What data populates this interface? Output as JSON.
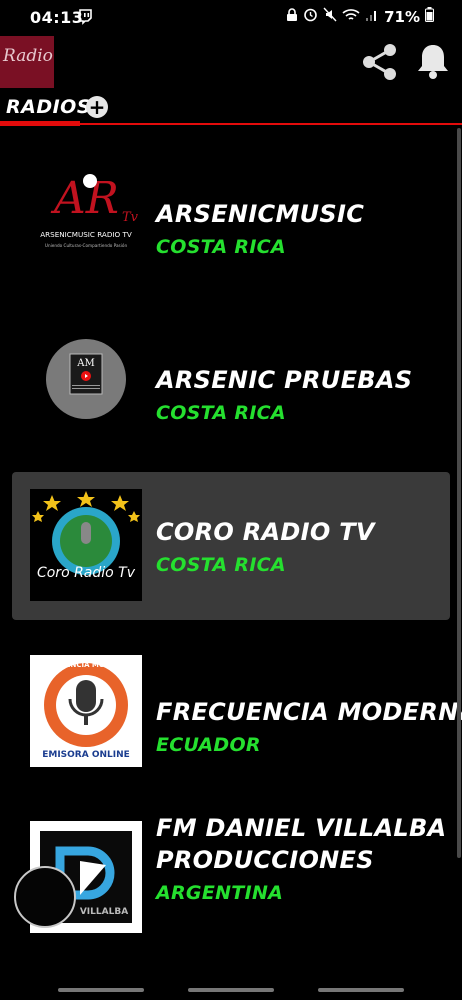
{
  "status": {
    "time": "04:13",
    "battery": "71%"
  },
  "appbar": {
    "logo_text": "Radio"
  },
  "tabs": {
    "radios_label": "RADIOS",
    "add_label": "+"
  },
  "stations": [
    {
      "name": "ARSENICMUSIC",
      "country": "COSTA RICA",
      "logo_text": "ARSENICMUSIC RADIO TV",
      "logo_sub": "Uniendo Culturas-Compartiendo Pasión",
      "logo_mono": "AR",
      "logo_tv": "Tv"
    },
    {
      "name": "ARSENIC PRUEBAS",
      "country": "COSTA RICA",
      "logo_mono": "AM"
    },
    {
      "name": "CORO RADIO TV",
      "country": "COSTA RICA",
      "logo_text": "Coro Radio Tv"
    },
    {
      "name": "FRECUENCIA MODERNA",
      "country": "ECUADOR",
      "logo_arc": "FRECUENCIA MODERNA",
      "logo_banner": "EMISORA ONLINE"
    },
    {
      "name_line1": "FM DANIEL VILLALBA",
      "name_line2": "PRODUCCIONES",
      "country": "ARGENTINA",
      "logo_text": "VILLALBA"
    }
  ],
  "colors": {
    "accent_red": "#e30b0b",
    "country_green": "#25e02f",
    "selected_bg": "#3a3a3a"
  }
}
